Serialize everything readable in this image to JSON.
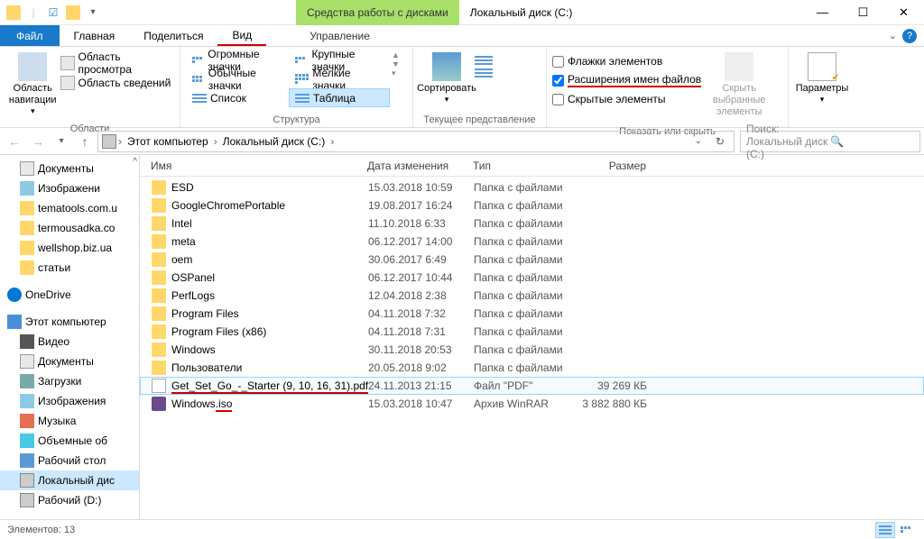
{
  "title": {
    "contextual": "Средства работы с дисками",
    "text": "Локальный диск (C:)"
  },
  "tabs": {
    "file": "Файл",
    "home": "Главная",
    "share": "Поделиться",
    "view": "Вид",
    "manage": "Управление"
  },
  "ribbon": {
    "g1": {
      "nav_pane": "Область навигации",
      "preview": "Область просмотра",
      "details": "Область сведений",
      "label": "Области"
    },
    "g2": {
      "huge": "Огромные значки",
      "large": "Крупные значки",
      "normal": "Обычные значки",
      "small": "Мелкие значки",
      "list": "Список",
      "table": "Таблица",
      "label": "Структура"
    },
    "g3": {
      "sort": "Сортировать",
      "label": "Текущее представление"
    },
    "g4": {
      "flags": "Флажки элементов",
      "ext": "Расширения имен файлов",
      "hidden": "Скрытые элементы",
      "hide_sel": "Скрыть выбранные элементы",
      "label": "Показать или скрыть"
    },
    "g5": {
      "params": "Параметры"
    }
  },
  "nav": {
    "crumb1": "Этот компьютер",
    "crumb2": "Локальный диск (C:)",
    "search_placeholder": "Поиск: Локальный диск (C:)"
  },
  "tree": [
    {
      "icon": "ic-doc",
      "label": "Документы"
    },
    {
      "icon": "ic-pic",
      "label": "Изображени"
    },
    {
      "icon": "ic-folder",
      "label": "tematools.com.u"
    },
    {
      "icon": "ic-folder",
      "label": "termousadka.co"
    },
    {
      "icon": "ic-folder",
      "label": "wellshop.biz.ua"
    },
    {
      "icon": "ic-folder",
      "label": "статьи"
    },
    {
      "icon": "ic-onedrive",
      "label": "OneDrive",
      "root": true,
      "spacer": true
    },
    {
      "icon": "ic-pc",
      "label": "Этот компьютер",
      "root": true,
      "spacer": true
    },
    {
      "icon": "ic-video",
      "label": "Видео"
    },
    {
      "icon": "ic-doc",
      "label": "Документы"
    },
    {
      "icon": "ic-down",
      "label": "Загрузки"
    },
    {
      "icon": "ic-pic",
      "label": "Изображения"
    },
    {
      "icon": "ic-music",
      "label": "Музыка"
    },
    {
      "icon": "ic-3d",
      "label": "Объемные об"
    },
    {
      "icon": "ic-desk",
      "label": "Рабочий стол"
    },
    {
      "icon": "ic-disk",
      "label": "Локальный дис",
      "sel": true
    },
    {
      "icon": "ic-disk",
      "label": "Рабочий (D:)"
    }
  ],
  "cols": {
    "name": "Имя",
    "date": "Дата изменения",
    "type": "Тип",
    "size": "Размер"
  },
  "rows": [
    {
      "i": "ric-folder",
      "n": "ESD",
      "d": "15.03.2018 10:59",
      "t": "Папка с файлами",
      "s": ""
    },
    {
      "i": "ric-folder",
      "n": "GoogleChromePortable",
      "d": "19.08.2017 16:24",
      "t": "Папка с файлами",
      "s": ""
    },
    {
      "i": "ric-folder",
      "n": "Intel",
      "d": "11.10.2018 6:33",
      "t": "Папка с файлами",
      "s": ""
    },
    {
      "i": "ric-folder",
      "n": "meta",
      "d": "06.12.2017 14:00",
      "t": "Папка с файлами",
      "s": ""
    },
    {
      "i": "ric-folder",
      "n": "oem",
      "d": "30.06.2017 6:49",
      "t": "Папка с файлами",
      "s": ""
    },
    {
      "i": "ric-folder",
      "n": "OSPanel",
      "d": "06.12.2017 10:44",
      "t": "Папка с файлами",
      "s": ""
    },
    {
      "i": "ric-folder",
      "n": "PerfLogs",
      "d": "12.04.2018 2:38",
      "t": "Папка с файлами",
      "s": ""
    },
    {
      "i": "ric-folder",
      "n": "Program Files",
      "d": "04.11.2018 7:32",
      "t": "Папка с файлами",
      "s": ""
    },
    {
      "i": "ric-folder",
      "n": "Program Files (x86)",
      "d": "04.11.2018 7:31",
      "t": "Папка с файлами",
      "s": ""
    },
    {
      "i": "ric-folder",
      "n": "Windows",
      "d": "30.11.2018 20:53",
      "t": "Папка с файлами",
      "s": ""
    },
    {
      "i": "ric-folder",
      "n": "Пользователи",
      "d": "20.05.2018 9:02",
      "t": "Папка с файлами",
      "s": ""
    },
    {
      "i": "ric-pdf",
      "n": "Get_Set_Go_-_Starter (9, 10, 16, 31).pdf",
      "d": "24.11.2013 21:15",
      "t": "Файл \"PDF\"",
      "s": "39 269 КБ",
      "sel": true,
      "ul": true
    },
    {
      "i": "ric-iso",
      "n": "Windows.iso",
      "d": "15.03.2018 10:47",
      "t": "Архив WinRAR",
      "s": "3 882 880 КБ",
      "ul_part": ".iso"
    }
  ],
  "status": {
    "count_label": "Элементов: 13"
  }
}
